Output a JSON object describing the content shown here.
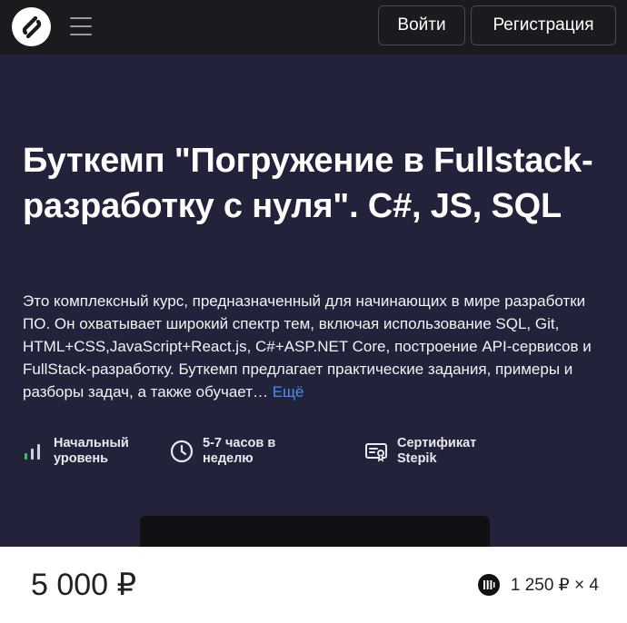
{
  "header": {
    "login_label": "Войти",
    "register_label": "Регистрация",
    "logo_icon": "stepik-logo-icon",
    "menu_icon": "hamburger-menu-icon"
  },
  "course": {
    "title": "Буткемп \"Погружение в Fullstack-разработку с нуля\". C#, JS, SQL",
    "description": "Это комплексный курс, предназначенный для начинающих в мире разработки ПО. Он охватывает широкий спектр тем, включая использование SQL, Git, HTML+CSS,JavaScript+React.js, C#+ASP.NET Core, построение API-сервисов и FullStack-разработку. Буткемп предлагает практические задания, примеры и разборы задач, а также обучает…",
    "more_label": "Ещё"
  },
  "features": {
    "level": {
      "icon": "level-bars-icon",
      "label": "Начальный уровень"
    },
    "time": {
      "icon": "clock-icon",
      "label": "5-7 часов в неделю"
    },
    "certificate": {
      "icon": "certificate-icon",
      "label": "Сертификат Stepik"
    }
  },
  "pricing": {
    "price": "5 000 ₽",
    "installment": "1 250 ₽ × 4",
    "installment_icon": "installment-icon"
  },
  "colors": {
    "header_bg": "#1b1b1f",
    "hero_bg": "#22233a",
    "accent_link": "#4d8df0",
    "level_green": "#3dbd5d"
  }
}
